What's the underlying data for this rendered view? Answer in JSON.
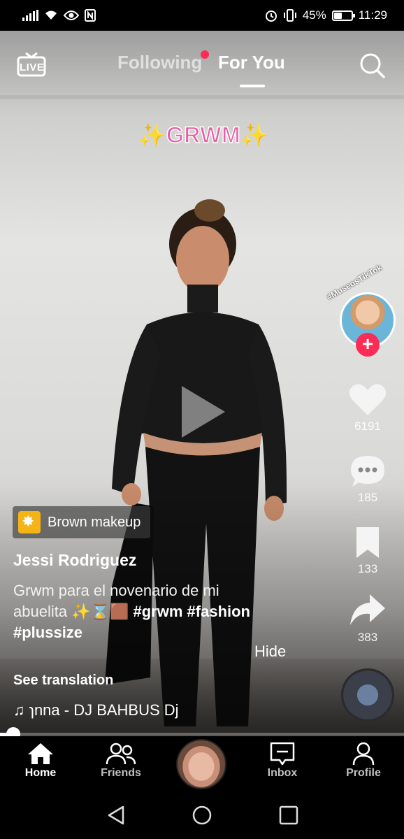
{
  "status_bar": {
    "battery_text": "45%",
    "battery_level": 0.45,
    "time": "11:29",
    "icons": [
      "signal-icon",
      "wifi-icon",
      "eye-icon",
      "nfc-icon",
      "alarm-icon",
      "vibrate-icon",
      "battery-icon"
    ]
  },
  "top_nav": {
    "live_label": "LIVE",
    "tab_following": "Following",
    "tab_for_you": "For You",
    "active_tab": "For You"
  },
  "video": {
    "overlay_text": "✨GRWM✨",
    "progress": 0.03
  },
  "creator": {
    "sticker_text": "#MuseosTikTok"
  },
  "actions": {
    "likes": "6191",
    "comments": "185",
    "saves": "133",
    "shares": "383"
  },
  "post": {
    "effect_label": "Brown makeup",
    "username": "Jessi Rodriguez",
    "caption_text": "Grwm para el novenario de mi abuelita ✨⌛🟫",
    "hashtags": [
      "#grwm",
      "#fashion",
      "#plussize"
    ],
    "hide_label": "Hide",
    "see_translation": "See translation",
    "music": "♫ ɿnna - DJ BAHBUS    Dj"
  },
  "bottom_nav": {
    "home": "Home",
    "friends": "Friends",
    "inbox": "Inbox",
    "profile": "Profile",
    "active": "Home"
  },
  "colors": {
    "accent": "#fe2c55",
    "overlay_pink": "#e75fa6",
    "effect_yellow": "#f5b316"
  }
}
